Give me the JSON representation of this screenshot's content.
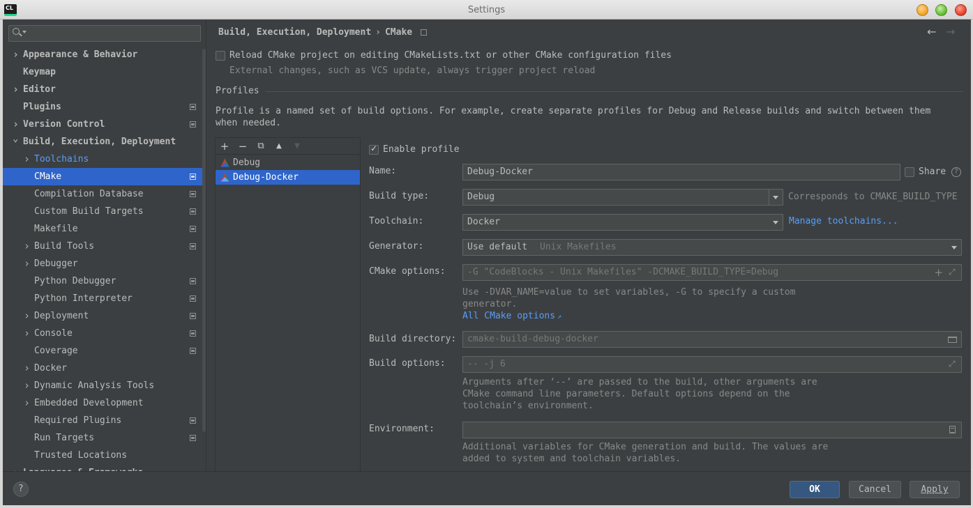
{
  "window": {
    "title": "Settings",
    "app_icon_text": "CL"
  },
  "search": {
    "placeholder": ""
  },
  "sidebar": {
    "items": [
      {
        "label": "Appearance & Behavior",
        "level": 0,
        "arrow": "right",
        "bold": true,
        "project": false
      },
      {
        "label": "Keymap",
        "level": 0,
        "arrow": "",
        "bold": true,
        "project": false
      },
      {
        "label": "Editor",
        "level": 0,
        "arrow": "right",
        "bold": true,
        "project": false
      },
      {
        "label": "Plugins",
        "level": 0,
        "arrow": "",
        "bold": true,
        "project": true
      },
      {
        "label": "Version Control",
        "level": 0,
        "arrow": "right",
        "bold": true,
        "project": true
      },
      {
        "label": "Build, Execution, Deployment",
        "level": 0,
        "arrow": "down",
        "bold": true,
        "project": false
      },
      {
        "label": "Toolchains",
        "level": 1,
        "arrow": "right",
        "bold": false,
        "project": false,
        "link": true
      },
      {
        "label": "CMake",
        "level": 1,
        "arrow": "",
        "bold": false,
        "project": true,
        "selected": true
      },
      {
        "label": "Compilation Database",
        "level": 1,
        "arrow": "",
        "bold": false,
        "project": true
      },
      {
        "label": "Custom Build Targets",
        "level": 1,
        "arrow": "",
        "bold": false,
        "project": true
      },
      {
        "label": "Makefile",
        "level": 1,
        "arrow": "",
        "bold": false,
        "project": true
      },
      {
        "label": "Build Tools",
        "level": 1,
        "arrow": "right",
        "bold": false,
        "project": true
      },
      {
        "label": "Debugger",
        "level": 1,
        "arrow": "right",
        "bold": false,
        "project": false
      },
      {
        "label": "Python Debugger",
        "level": 1,
        "arrow": "",
        "bold": false,
        "project": true
      },
      {
        "label": "Python Interpreter",
        "level": 1,
        "arrow": "",
        "bold": false,
        "project": true
      },
      {
        "label": "Deployment",
        "level": 1,
        "arrow": "right",
        "bold": false,
        "project": true
      },
      {
        "label": "Console",
        "level": 1,
        "arrow": "right",
        "bold": false,
        "project": true
      },
      {
        "label": "Coverage",
        "level": 1,
        "arrow": "",
        "bold": false,
        "project": true
      },
      {
        "label": "Docker",
        "level": 1,
        "arrow": "right",
        "bold": false,
        "project": false
      },
      {
        "label": "Dynamic Analysis Tools",
        "level": 1,
        "arrow": "right",
        "bold": false,
        "project": false
      },
      {
        "label": "Embedded Development",
        "level": 1,
        "arrow": "right",
        "bold": false,
        "project": false
      },
      {
        "label": "Required Plugins",
        "level": 1,
        "arrow": "",
        "bold": false,
        "project": true
      },
      {
        "label": "Run Targets",
        "level": 1,
        "arrow": "",
        "bold": false,
        "project": true
      },
      {
        "label": "Trusted Locations",
        "level": 1,
        "arrow": "",
        "bold": false,
        "project": false
      },
      {
        "label": "Languages & Frameworks",
        "level": 0,
        "arrow": "right",
        "bold": true,
        "project": false
      }
    ]
  },
  "breadcrumb": {
    "parent": "Build, Execution, Deployment",
    "separator": "›",
    "current": "CMake"
  },
  "reload": {
    "checked": false,
    "label": "Reload CMake project on editing CMakeLists.txt or other CMake configuration files",
    "hint": "External changes, such as VCS update, always trigger project reload"
  },
  "profiles": {
    "section_title": "Profiles",
    "description_line1": "Profile is a named set of build options. For example, create separate profiles for Debug and Release builds and switch between them",
    "description_line2": "when needed.",
    "list": [
      {
        "name": "Debug",
        "selected": false
      },
      {
        "name": "Debug-Docker",
        "selected": true
      }
    ],
    "toolbar": {
      "add": "+",
      "remove": "−",
      "copy": "⧉",
      "up": "▲",
      "down": "▼"
    }
  },
  "form": {
    "enable_profile": {
      "label": "Enable profile",
      "checked": true
    },
    "name": {
      "label": "Name:",
      "value": "Debug-Docker"
    },
    "share": {
      "label": "Share",
      "checked": false,
      "help": "?"
    },
    "build_type": {
      "label": "Build type:",
      "value": "Debug",
      "hint": "Corresponds to CMAKE_BUILD_TYPE"
    },
    "toolchain": {
      "label": "Toolchain:",
      "value": "Docker",
      "link": "Manage toolchains..."
    },
    "generator": {
      "label": "Generator:",
      "value": "Use default",
      "hint": "Unix Makefiles"
    },
    "cmake_options": {
      "label": "CMake options:",
      "placeholder": "-G \"CodeBlocks - Unix Makefiles\" -DCMAKE_BUILD_TYPE=Debug",
      "help_line1": "Use -DVAR_NAME=value to set variables, -G to specify a custom",
      "help_line2": "generator.",
      "link": "All CMake options",
      "link_arrow": "↗"
    },
    "build_directory": {
      "label": "Build directory:",
      "placeholder": "cmake-build-debug-docker"
    },
    "build_options": {
      "label": "Build options:",
      "placeholder": "-- -j 6",
      "help_line1": "Arguments after ‘--’ are passed to the build, other arguments are",
      "help_line2": "CMake command line parameters. Default options depend on the",
      "help_line3": "toolchain’s environment."
    },
    "environment": {
      "label": "Environment:",
      "value": "",
      "help_line1": "Additional variables for CMake generation and build. The values are",
      "help_line2": "added to system and toolchain variables."
    }
  },
  "buttons": {
    "help": "?",
    "ok": "OK",
    "cancel": "Cancel",
    "apply": "Apply"
  },
  "nav": {
    "back": "←",
    "forward": "→"
  },
  "colors": {
    "selection": "#2f65ca",
    "link": "#589df6",
    "background": "#3c3f41",
    "ok_button": "#365880"
  }
}
